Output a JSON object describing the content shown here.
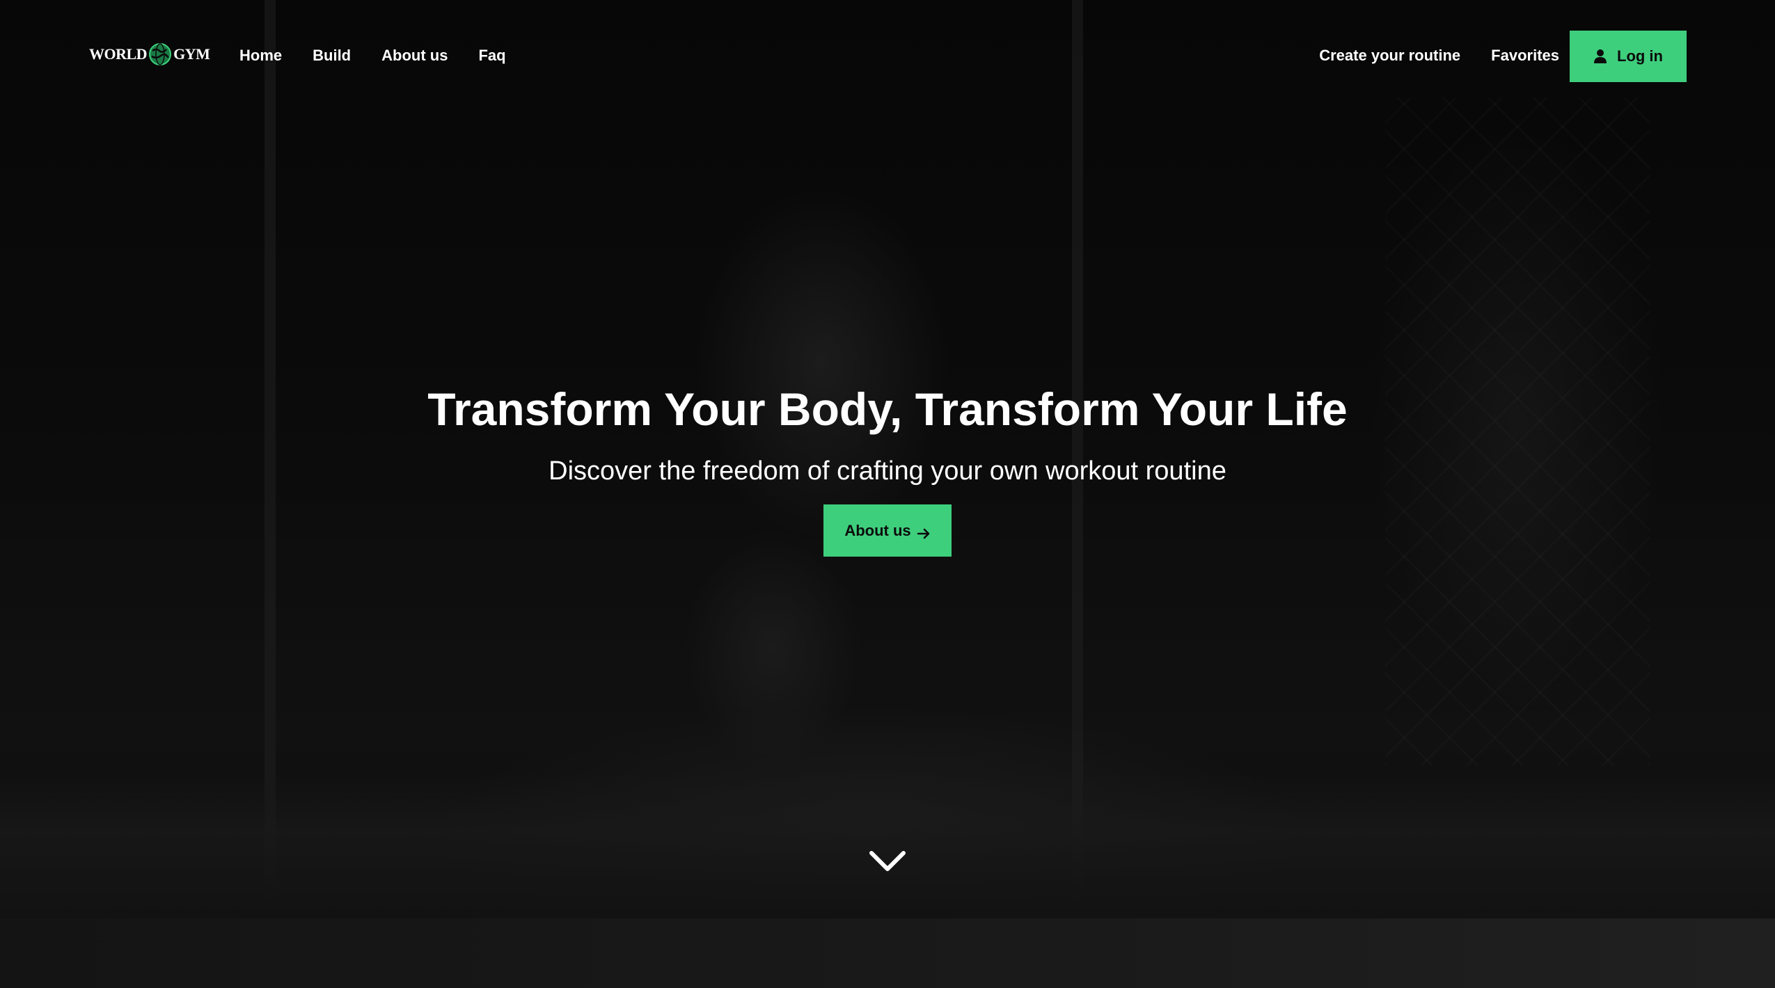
{
  "brand": {
    "logo_left": "WORLD",
    "logo_right": "GYM",
    "logo_icon": "globe-icon"
  },
  "nav": {
    "left": [
      {
        "label": "Home"
      },
      {
        "label": "Build"
      },
      {
        "label": "About us"
      },
      {
        "label": "Faq"
      }
    ],
    "right": [
      {
        "label": "Create your routine"
      },
      {
        "label": "Favorites"
      }
    ],
    "login": {
      "label": "Log in",
      "icon": "user-icon"
    }
  },
  "hero": {
    "title": "Transform Your Body, Transform Your Life",
    "subtitle": "Discover the freedom of crafting your own workout routine",
    "cta": {
      "label": "About us",
      "icon": "arrow-right-icon"
    },
    "scroll_icon": "chevron-down-icon"
  },
  "colors": {
    "accent": "#3ecf7d",
    "background": "#000000",
    "text": "#ffffff"
  }
}
